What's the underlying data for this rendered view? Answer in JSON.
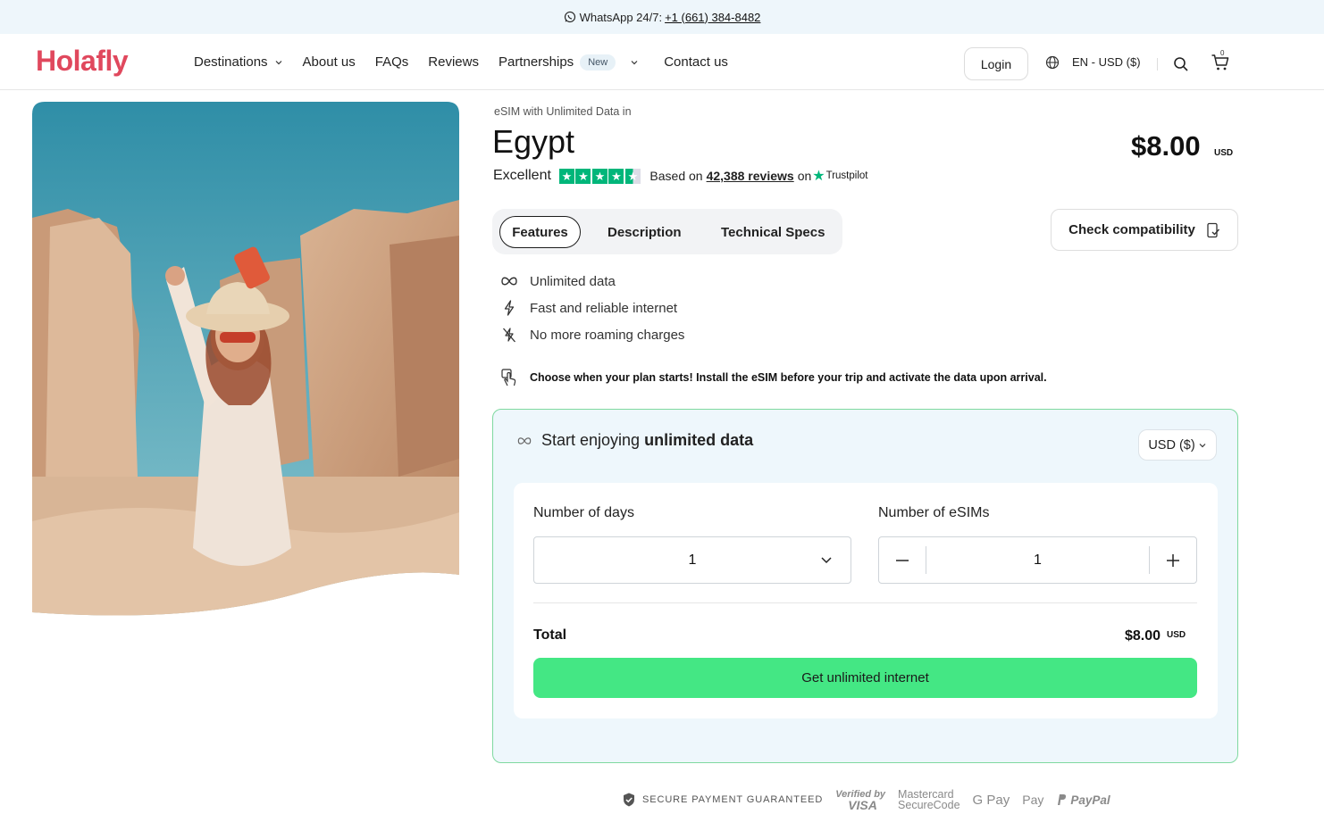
{
  "topbar": {
    "prefix": "WhatsApp 24/7:",
    "phone": "+1 (661) 384-8482"
  },
  "header": {
    "logo": "Holafly",
    "nav": [
      {
        "label": "Destinations"
      },
      {
        "label": "About us"
      },
      {
        "label": "FAQs"
      },
      {
        "label": "Reviews"
      },
      {
        "label": "Partnerships",
        "badge": "New"
      },
      {
        "label": "Contact us"
      }
    ],
    "login": "Login",
    "lang": "EN - USD ($)",
    "cart_count": "0"
  },
  "product": {
    "eyebrow": "eSIM with Unlimited Data in",
    "title": "Egypt",
    "price": "$8.00",
    "price_currency": "USD",
    "rating_text": "Excellent",
    "stars": 4.5,
    "based_on": "Based on",
    "reviews": "42,388 reviews",
    "on": "on",
    "trustpilot": "Trustpilot"
  },
  "tabs": [
    "Features",
    "Description",
    "Technical Specs"
  ],
  "check_compat": "Check compatibility",
  "features": [
    "Unlimited data",
    "Fast and reliable internet",
    "No more roaming charges"
  ],
  "notice": "Choose when your plan starts! Install the eSIM before your trip and activate the data upon arrival.",
  "card": {
    "heading_prefix": "Start enjoying",
    "heading_bold": "unlimited data",
    "currency_select": "USD ($)",
    "days_label": "Number of days",
    "days_value": "1",
    "esims_label": "Number of eSIMs",
    "esims_value": "1",
    "total_label": "Total",
    "total_value": "$8.00",
    "total_currency": "USD",
    "cta": "Get unlimited internet"
  },
  "payments": {
    "secure": "SECURE PAYMENT GUARANTEED",
    "visa_top": "Verified by",
    "visa_bottom": "VISA",
    "mc_top": "Mastercard",
    "mc_bottom": "SecureCode",
    "gpay": "G Pay",
    "apay": "Pay",
    "paypal": "PayPal"
  },
  "colors": {
    "brand": "#e0485d",
    "cta": "#44e784",
    "card_border": "#7fd9a0",
    "trustpilot": "#00b67a"
  }
}
